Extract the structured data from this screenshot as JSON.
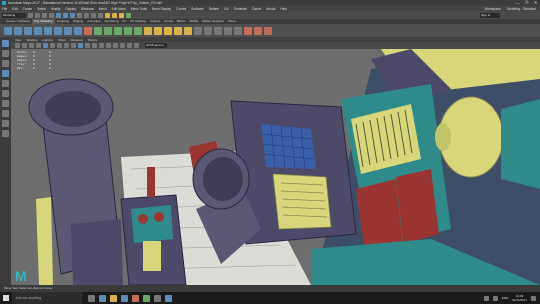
{
  "window": {
    "title": "Autodesk Maya 2017 - Educational Version: D:\\Al\\Natl Sem Anal\\3D High Poly\\Hi Poly_Vulture_R3.mb*",
    "controls": [
      "—",
      "❐",
      "✕"
    ]
  },
  "menubar": {
    "items": [
      "File",
      "Edit",
      "Create",
      "Select",
      "Modify",
      "Display",
      "Windows",
      "Mesh",
      "Edit Mesh",
      "Mesh Tools",
      "Mesh Display",
      "Curves",
      "Surfaces",
      "Deform",
      "UV",
      "Generate",
      "Cache",
      "Arnold",
      "Help"
    ],
    "workspace_label": "Workspace:",
    "workspace_value": "Modeling - Standard"
  },
  "statusline": {
    "mode": "Modeling",
    "sign_in": "Sign In"
  },
  "shelf_tabs": {
    "items": [
      "Curves / Surfaces",
      "Poly Modeling",
      "Sculpting",
      "Rigging",
      "Animation",
      "Rendering",
      "FX",
      "FX Caching",
      "Custom",
      "Arnold",
      "Bifrost",
      "MASH",
      "Motion Graphics",
      "XGen"
    ],
    "active": "Poly Modeling"
  },
  "viewport": {
    "menu": [
      "View",
      "Shading",
      "Lighting",
      "Show",
      "Renderer",
      "Panels"
    ],
    "camera_field": "sRGB gamma",
    "hud": [
      [
        "Verts:",
        "",
        "0",
        "0"
      ],
      [
        "Edges:",
        "",
        "0",
        "0"
      ],
      [
        "Faces:",
        "",
        "0",
        "0"
      ],
      [
        "Tris:",
        "",
        "0",
        "0"
      ],
      [
        "UVs:",
        "",
        "0",
        "0"
      ]
    ]
  },
  "helpline": {
    "text": "Move Tool: Select an object to move."
  },
  "taskbar": {
    "search_placeholder": "Ask me anything",
    "lang": "ENG",
    "time": "12:03",
    "date": "02/11/2017"
  },
  "colors": {
    "viewport_bg": "#6d6d6d",
    "model_purple": "#4d4a69",
    "model_teal": "#2f8a8a",
    "model_yellow": "#d8d67a",
    "model_red": "#9b3534",
    "grid_blue": "#3b5fa8"
  }
}
